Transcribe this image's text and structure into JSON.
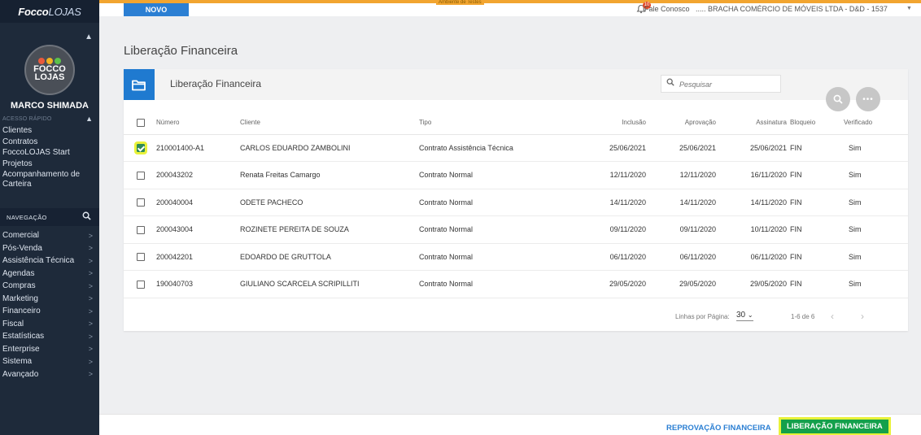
{
  "app": {
    "logo_bold": "Focco",
    "logo_light": "LOJAS",
    "env_tag": "Ambiente de Testes"
  },
  "sidebar": {
    "avatar_line1": "FOCCO",
    "avatar_line2": "LOJAS",
    "avatar_colors": [
      "#e85a3c",
      "#f2b320",
      "#5cc24a"
    ],
    "user_name": "MARCO SHIMADA",
    "quick_access_header": "ACESSO RÁPIDO",
    "quick_access": [
      "Clientes",
      "Contratos",
      "FoccoLOJAS Start",
      "Projetos",
      "Acompanhamento de Carteira"
    ],
    "nav_header": "NAVEGAÇÃO",
    "nav_items": [
      "Comercial",
      "Pós-Venda",
      "Assistência Técnica",
      "Agendas",
      "Compras",
      "Marketing",
      "Financeiro",
      "Fiscal",
      "Estatísticas",
      "Enterprise",
      "Sistema",
      "Avançado"
    ]
  },
  "topbar": {
    "new_button": "NOVO",
    "notification_count": "10",
    "contact_link": "Fale Conosco",
    "company": "..... BRACHA COMÉRCIO DE MÓVEIS LTDA - D&D - 1537"
  },
  "page": {
    "title": "Liberação Financeira",
    "panel_title": "Liberação Financeira",
    "search_placeholder": "Pesquisar"
  },
  "table": {
    "columns": [
      "Número",
      "Cliente",
      "Tipo",
      "Inclusão",
      "Aprovação",
      "Assinatura",
      "Bloqueio",
      "Verificado"
    ],
    "rows": [
      {
        "checked": true,
        "numero": "210001400-A1",
        "cliente": "CARLOS EDUARDO ZAMBOLINI",
        "tipo": "Contrato Assistência Técnica",
        "inclusao": "25/06/2021",
        "aprovacao": "25/06/2021",
        "assinatura": "25/06/2021",
        "bloqueio": "FIN",
        "verificado": "Sim"
      },
      {
        "checked": false,
        "numero": "200043202",
        "cliente": "Renata Freitas Camargo",
        "tipo": "Contrato Normal",
        "inclusao": "12/11/2020",
        "aprovacao": "12/11/2020",
        "assinatura": "16/11/2020",
        "bloqueio": "FIN",
        "verificado": "Sim"
      },
      {
        "checked": false,
        "numero": "200040004",
        "cliente": "ODETE PACHECO",
        "tipo": "Contrato Normal",
        "inclusao": "14/11/2020",
        "aprovacao": "14/11/2020",
        "assinatura": "14/11/2020",
        "bloqueio": "FIN",
        "verificado": "Sim"
      },
      {
        "checked": false,
        "numero": "200043004",
        "cliente": "ROZINETE PEREITA DE SOUZA",
        "tipo": "Contrato Normal",
        "inclusao": "09/11/2020",
        "aprovacao": "09/11/2020",
        "assinatura": "10/11/2020",
        "bloqueio": "FIN",
        "verificado": "Sim"
      },
      {
        "checked": false,
        "numero": "200042201",
        "cliente": "EDOARDO DE GRUTTOLA",
        "tipo": "Contrato Normal",
        "inclusao": "06/11/2020",
        "aprovacao": "06/11/2020",
        "assinatura": "06/11/2020",
        "bloqueio": "FIN",
        "verificado": "Sim"
      },
      {
        "checked": false,
        "numero": "190040703",
        "cliente": "GIULIANO SCARCELA SCRIPILLITI",
        "tipo": "Contrato Normal",
        "inclusao": "29/05/2020",
        "aprovacao": "29/05/2020",
        "assinatura": "29/05/2020",
        "bloqueio": "FIN",
        "verificado": "Sim"
      }
    ]
  },
  "pager": {
    "rows_label": "Linhas por Página:",
    "rows_value": "30",
    "range": "1-6 de 6"
  },
  "footer": {
    "reject_button": "REPROVAÇÃO FINANCEIRA",
    "approve_button": "LIBERAÇÃO FINANCEIRA"
  },
  "colors": {
    "sidebar": "#1e2a3a",
    "accent": "#2b7fd3",
    "env_bar": "#f2a530",
    "approve": "#14a04b",
    "highlight": "#e9f23a"
  }
}
